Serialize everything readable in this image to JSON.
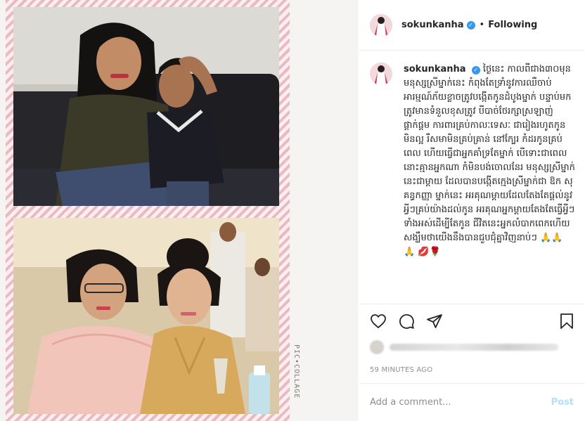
{
  "header": {
    "username": "sokunkanha",
    "separator": "•",
    "follow_status": "Following"
  },
  "caption": {
    "username": "sokunkanha",
    "text": "ថ្ងៃនេះ កាលពីជាង៣០មុន មនុស្សស្រីម្នាក់នេះ កំពុងតែទ្រាំនូវការឈឺចាប់ អារម្មណ៍ភ័យខ្លាចត្រូវបង្កើតកូនដំបូងម្នាក់ បន្ទាប់មកត្រូវមានទំនួលខុសត្រូវ បីបាច់ថែរក្សាស្រឡាញ់ ផ្គាក់ផ្គម ការពារគ្រប់កាលៈទេសៈ ជារៀងរហូតកូនមិនល្អ រឺសមាមិនគ្រប់គ្រាន់ នៅក្បែរ កំដរកូនគ្រប់ពេល ហើយធ្វើជាអ្នកគាំទ្រតែម្នាក់ បើទោះជាពេលនោះគ្មានអ្នកណា កំមិនបង់ចោលនែរ មនុស្សស្រីម្នាក់នេះជាម្តាយ ដែលបានបង្កើតក្មេងស្រីម្នាក់ជា ឱក សុគន្ធកញ្ញា ម្នាក់នេះ អរគុណម្តាយដែលតែងតែផ្តល់នូវអ្វីៗគ្រប់យ៉ាងដល់កូន អរគុណអ្នកម្តាយតែងតែធ្វើអ្វីៗទាំងអស់ដើម្បីតែកូន ជីវិតនេះអ្នកលំបាកពេកហើយ សង្ឃឹមថាយើងនឹងបានជួបជុំគ្នាវិញនាប់ៗ 🙏🙏 🙏 💋🌹"
  },
  "footer": {
    "timestamp": "59 MINUTES AGO",
    "comment_placeholder": "Add a comment...",
    "post_label": "Post"
  },
  "collage": {
    "watermark": "PIC•COLLAGE"
  },
  "icons": {
    "verified": "verified-badge-icon",
    "like": "heart-icon",
    "comment": "comment-bubble-icon",
    "share": "paper-plane-icon",
    "save": "bookmark-icon"
  },
  "colors": {
    "verified_blue": "#3897f0",
    "post_button_disabled": "#b2dffc",
    "secondary_text": "#8e8e8e",
    "border": "#efefef",
    "collage_stripe": "#eab9c2"
  }
}
